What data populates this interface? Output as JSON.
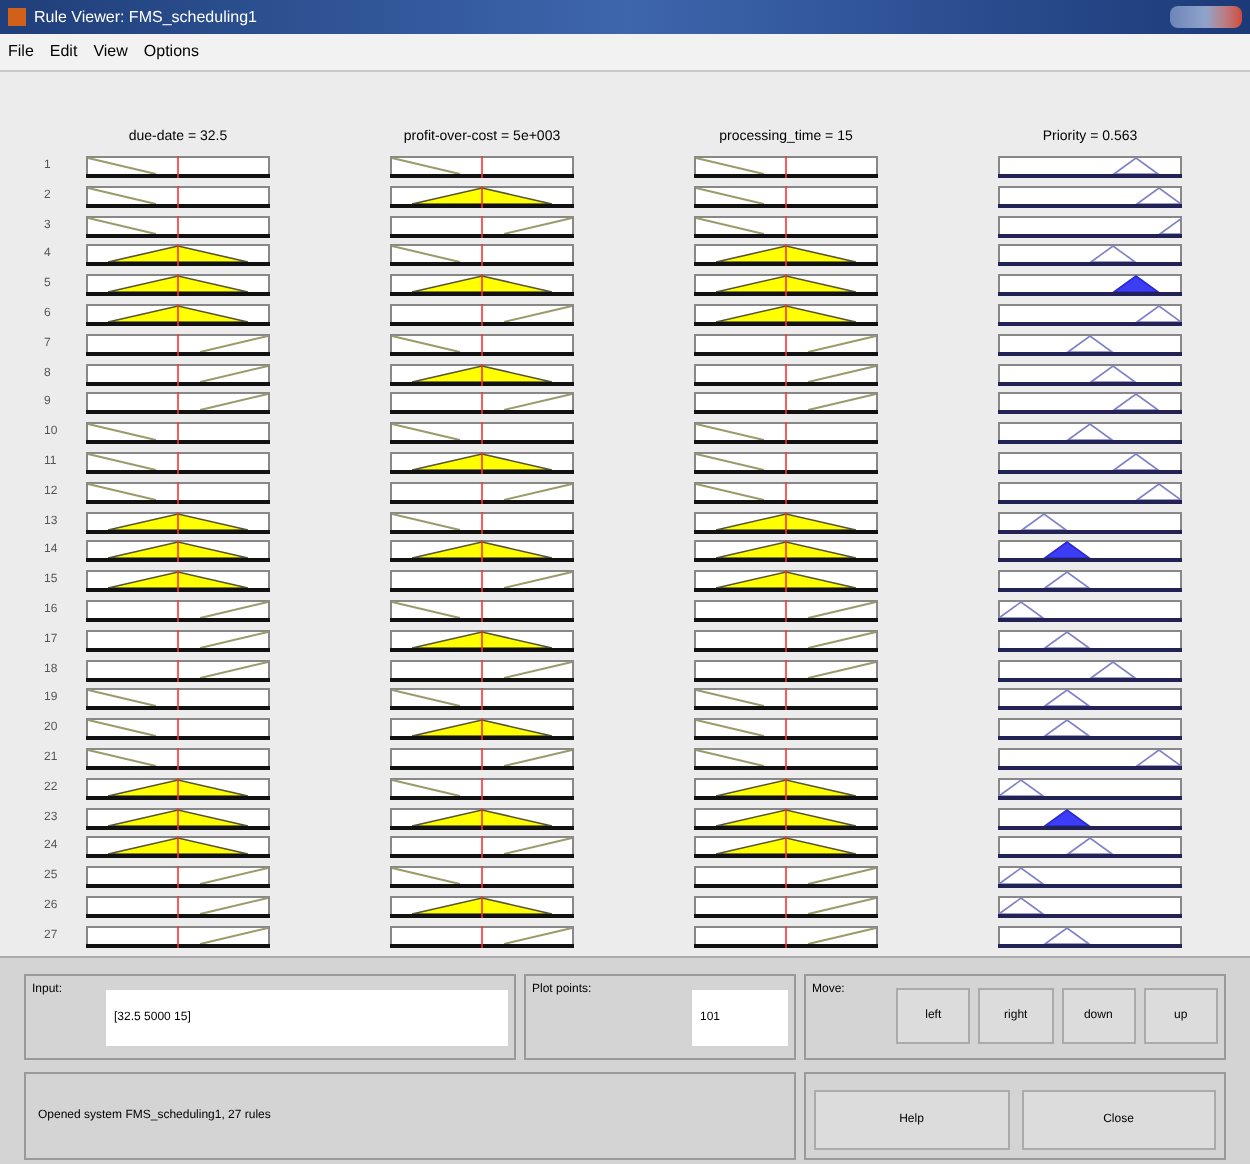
{
  "window": {
    "title": "Rule Viewer: FMS_scheduling1"
  },
  "menu": [
    "File",
    "Edit",
    "View",
    "Options"
  ],
  "variables": [
    {
      "label": "due-date = 32.5",
      "kind": "input"
    },
    {
      "label": "profit-over-cost = 5e+003",
      "kind": "input"
    },
    {
      "label": "processing_time = 15",
      "kind": "input"
    },
    {
      "label": "Priority = 0.563",
      "kind": "output"
    }
  ],
  "rules": [
    {
      "number": "1",
      "inputs": [
        {
          "kind": "low"
        },
        {
          "kind": "low"
        },
        {
          "kind": "low"
        }
      ],
      "output": {
        "kind": "mf6",
        "filled": false
      }
    },
    {
      "number": "2",
      "inputs": [
        {
          "kind": "low"
        },
        {
          "kind": "mid"
        },
        {
          "kind": "low"
        }
      ],
      "output": {
        "kind": "mf7",
        "filled": false
      }
    },
    {
      "number": "3",
      "inputs": [
        {
          "kind": "low"
        },
        {
          "kind": "high"
        },
        {
          "kind": "low"
        }
      ],
      "output": {
        "kind": "mf8",
        "filled": false
      }
    },
    {
      "number": "4",
      "inputs": [
        {
          "kind": "mid"
        },
        {
          "kind": "low"
        },
        {
          "kind": "mid"
        }
      ],
      "output": {
        "kind": "mf5",
        "filled": false
      }
    },
    {
      "number": "5",
      "inputs": [
        {
          "kind": "mid"
        },
        {
          "kind": "mid"
        },
        {
          "kind": "mid"
        }
      ],
      "output": {
        "kind": "mf6",
        "filled": true
      }
    },
    {
      "number": "6",
      "inputs": [
        {
          "kind": "mid"
        },
        {
          "kind": "high"
        },
        {
          "kind": "mid"
        }
      ],
      "output": {
        "kind": "mf7",
        "filled": false
      }
    },
    {
      "number": "7",
      "inputs": [
        {
          "kind": "high"
        },
        {
          "kind": "low"
        },
        {
          "kind": "high"
        }
      ],
      "output": {
        "kind": "mf4",
        "filled": false
      }
    },
    {
      "number": "8",
      "inputs": [
        {
          "kind": "high"
        },
        {
          "kind": "mid"
        },
        {
          "kind": "high"
        }
      ],
      "output": {
        "kind": "mf5",
        "filled": false
      }
    },
    {
      "number": "9",
      "inputs": [
        {
          "kind": "high"
        },
        {
          "kind": "high"
        },
        {
          "kind": "high"
        }
      ],
      "output": {
        "kind": "mf6",
        "filled": false
      }
    },
    {
      "number": "10",
      "inputs": [
        {
          "kind": "low"
        },
        {
          "kind": "low"
        },
        {
          "kind": "low"
        }
      ],
      "output": {
        "kind": "mf4",
        "filled": false
      }
    },
    {
      "number": "11",
      "inputs": [
        {
          "kind": "low"
        },
        {
          "kind": "mid"
        },
        {
          "kind": "low"
        }
      ],
      "output": {
        "kind": "mf6",
        "filled": false
      }
    },
    {
      "number": "12",
      "inputs": [
        {
          "kind": "low"
        },
        {
          "kind": "high"
        },
        {
          "kind": "low"
        }
      ],
      "output": {
        "kind": "mf7",
        "filled": false
      }
    },
    {
      "number": "13",
      "inputs": [
        {
          "kind": "mid"
        },
        {
          "kind": "low"
        },
        {
          "kind": "mid"
        }
      ],
      "output": {
        "kind": "mf2",
        "filled": false
      }
    },
    {
      "number": "14",
      "inputs": [
        {
          "kind": "mid"
        },
        {
          "kind": "mid"
        },
        {
          "kind": "mid"
        }
      ],
      "output": {
        "kind": "mf3",
        "filled": true
      }
    },
    {
      "number": "15",
      "inputs": [
        {
          "kind": "mid"
        },
        {
          "kind": "high"
        },
        {
          "kind": "mid"
        }
      ],
      "output": {
        "kind": "mf3",
        "filled": false
      }
    },
    {
      "number": "16",
      "inputs": [
        {
          "kind": "high"
        },
        {
          "kind": "low"
        },
        {
          "kind": "high"
        }
      ],
      "output": {
        "kind": "mf1",
        "filled": false
      }
    },
    {
      "number": "17",
      "inputs": [
        {
          "kind": "high"
        },
        {
          "kind": "mid"
        },
        {
          "kind": "high"
        }
      ],
      "output": {
        "kind": "mf3",
        "filled": false
      }
    },
    {
      "number": "18",
      "inputs": [
        {
          "kind": "high"
        },
        {
          "kind": "high"
        },
        {
          "kind": "high"
        }
      ],
      "output": {
        "kind": "mf5",
        "filled": false
      }
    },
    {
      "number": "19",
      "inputs": [
        {
          "kind": "low"
        },
        {
          "kind": "low"
        },
        {
          "kind": "low"
        }
      ],
      "output": {
        "kind": "mf3",
        "filled": false
      }
    },
    {
      "number": "20",
      "inputs": [
        {
          "kind": "low"
        },
        {
          "kind": "mid"
        },
        {
          "kind": "low"
        }
      ],
      "output": {
        "kind": "mf3",
        "filled": false
      }
    },
    {
      "number": "21",
      "inputs": [
        {
          "kind": "low"
        },
        {
          "kind": "high"
        },
        {
          "kind": "low"
        }
      ],
      "output": {
        "kind": "mf7",
        "filled": false
      }
    },
    {
      "number": "22",
      "inputs": [
        {
          "kind": "mid"
        },
        {
          "kind": "low"
        },
        {
          "kind": "mid"
        }
      ],
      "output": {
        "kind": "mf1",
        "filled": false
      }
    },
    {
      "number": "23",
      "inputs": [
        {
          "kind": "mid"
        },
        {
          "kind": "mid"
        },
        {
          "kind": "mid"
        }
      ],
      "output": {
        "kind": "mf3",
        "filled": true
      }
    },
    {
      "number": "24",
      "inputs": [
        {
          "kind": "mid"
        },
        {
          "kind": "high"
        },
        {
          "kind": "mid"
        }
      ],
      "output": {
        "kind": "mf4",
        "filled": false
      }
    },
    {
      "number": "25",
      "inputs": [
        {
          "kind": "high"
        },
        {
          "kind": "low"
        },
        {
          "kind": "high"
        }
      ],
      "output": {
        "kind": "mf1",
        "filled": false
      }
    },
    {
      "number": "26",
      "inputs": [
        {
          "kind": "high"
        },
        {
          "kind": "mid"
        },
        {
          "kind": "high"
        }
      ],
      "output": {
        "kind": "mf1",
        "filled": false
      }
    },
    {
      "number": "27",
      "inputs": [
        {
          "kind": "high"
        },
        {
          "kind": "high"
        },
        {
          "kind": "high"
        }
      ],
      "output": {
        "kind": "mf3",
        "filled": false
      }
    }
  ],
  "input": {
    "label": "Input:",
    "value": "[32.5 5000 15]"
  },
  "plot_points": {
    "label": "Plot points:",
    "value": "101"
  },
  "move": {
    "label": "Move:",
    "buttons": [
      "left",
      "right",
      "down",
      "up"
    ]
  },
  "status": "Opened system FMS_scheduling1, 27 rules",
  "buttons": [
    "Help",
    "Close"
  ]
}
